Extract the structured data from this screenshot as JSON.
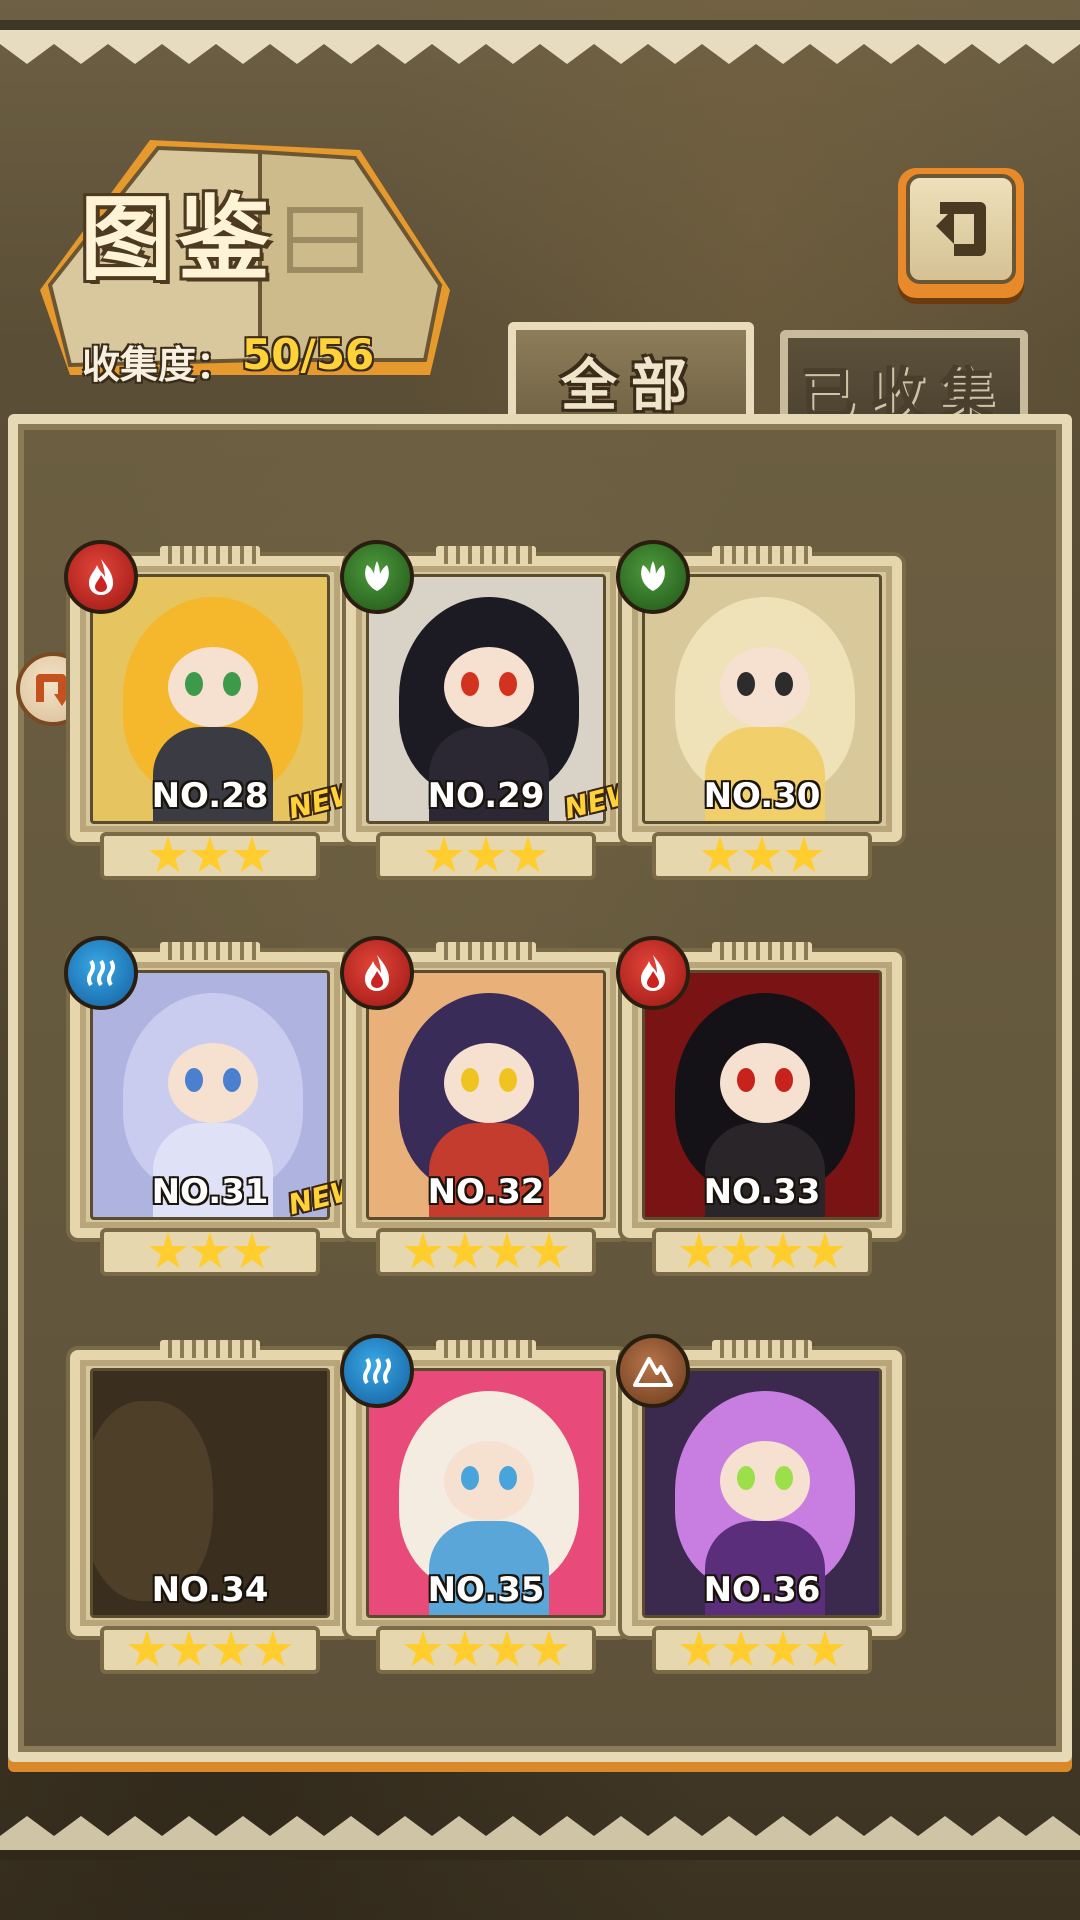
{
  "header": {
    "title": "图鉴",
    "collection_label": "收集度：",
    "collection_value": "50/56"
  },
  "tabs": [
    {
      "label": "全部",
      "active": true
    },
    {
      "label": "已收集",
      "active": false
    }
  ],
  "cards": [
    {
      "number": "NO.28",
      "element": "fire",
      "stars": 3,
      "new_label": "NEW",
      "hair": "#f5b72b",
      "eyes": "#3d9a4a",
      "body": "#3b3b44",
      "bg": "#e6c460"
    },
    {
      "number": "NO.29",
      "element": "leaf",
      "stars": 3,
      "new_label": "NEW",
      "hair": "#1c1a22",
      "eyes": "#d2321e",
      "body": "#2b2833",
      "bg": "#d9d2c6"
    },
    {
      "number": "NO.30",
      "element": "leaf",
      "stars": 3,
      "new_label": "",
      "hair": "#efe2b8",
      "eyes": "#2c2c2c",
      "body": "#f1cf6a",
      "bg": "#d8c89a"
    },
    {
      "number": "NO.31",
      "element": "water",
      "stars": 3,
      "new_label": "NEW",
      "hair": "#c9ccee",
      "eyes": "#4b7fd0",
      "body": "#dfe2f7",
      "bg": "#aeb3e0"
    },
    {
      "number": "NO.32",
      "element": "fire",
      "stars": 4,
      "new_label": "",
      "hair": "#3a2c58",
      "eyes": "#f0c420",
      "body": "#c43c2e",
      "bg": "#e9b07a"
    },
    {
      "number": "NO.33",
      "element": "fire",
      "stars": 4,
      "new_label": "",
      "hair": "#151217",
      "eyes": "#c8221c",
      "body": "#2a2528",
      "bg": "#7a1414"
    },
    {
      "number": "NO.34",
      "element": "",
      "stars": 4,
      "new_label": "",
      "locked": true
    },
    {
      "number": "NO.35",
      "element": "water",
      "stars": 4,
      "new_label": "",
      "hair": "#f4ece0",
      "eyes": "#4aa4dc",
      "body": "#5aa6d8",
      "bg": "#e84a7a"
    },
    {
      "number": "NO.36",
      "element": "earth",
      "stars": 4,
      "new_label": "",
      "hair": "#c77ee0",
      "eyes": "#9be04a",
      "body": "#5a2e7a",
      "bg": "#3b2a4e"
    }
  ],
  "icons": {
    "back": "back-arrow-icon",
    "fire": "flame-icon",
    "leaf": "leaf-icon",
    "water": "water-waves-icon",
    "earth": "mountain-icon"
  }
}
